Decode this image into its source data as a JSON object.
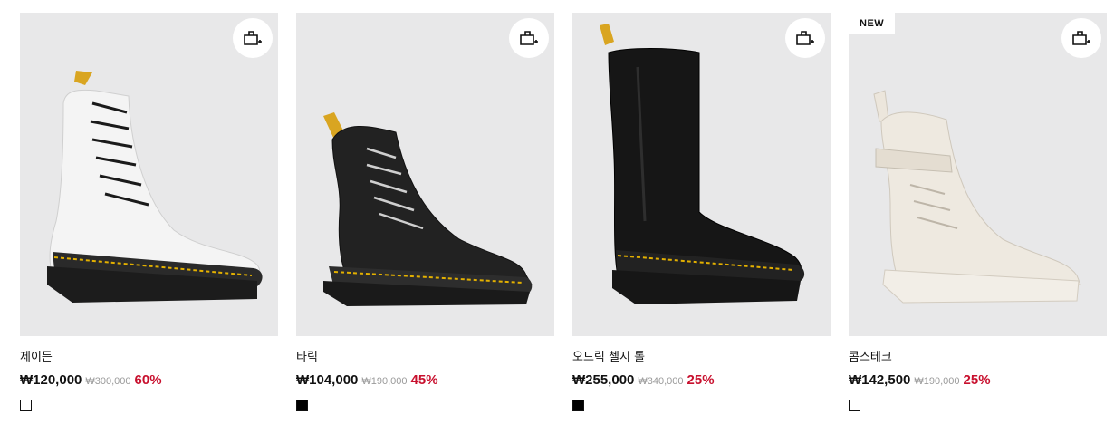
{
  "products": [
    {
      "name": "제이든",
      "price": "₩120,000",
      "original_price": "₩300,000",
      "discount": "60%",
      "swatch_color": "#ffffff",
      "badge": "",
      "cart_icon": "add-to-cart-icon"
    },
    {
      "name": "타릭",
      "price": "₩104,000",
      "original_price": "₩190,000",
      "discount": "45%",
      "swatch_color": "#000000",
      "badge": "",
      "cart_icon": "add-to-cart-icon"
    },
    {
      "name": "오드릭 첼시 톨",
      "price": "₩255,000",
      "original_price": "₩340,000",
      "discount": "25%",
      "swatch_color": "#000000",
      "badge": "",
      "cart_icon": "add-to-cart-icon"
    },
    {
      "name": "콤스테크",
      "price": "₩142,500",
      "original_price": "₩190,000",
      "discount": "25%",
      "swatch_color": "#ffffff",
      "badge": "NEW",
      "cart_icon": "add-to-cart-icon"
    }
  ],
  "colors": {
    "discount": "#c8102e",
    "image_bg": "#e8e8e9",
    "strike": "#9a9a9a"
  }
}
